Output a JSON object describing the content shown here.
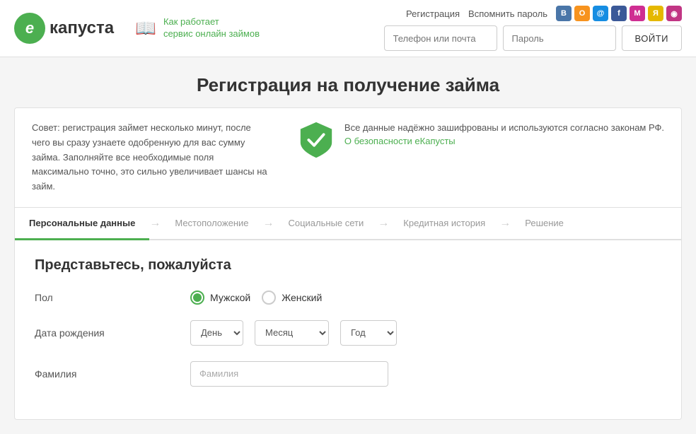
{
  "header": {
    "logo_letter": "е",
    "logo_name": "капуста",
    "how_it_works_line1": "Как работает",
    "how_it_works_line2": "сервис онлайн займов",
    "links": {
      "register": "Регистрация",
      "forgot": "Вспомнить пароль"
    },
    "social_icons": [
      {
        "name": "vk",
        "color": "#4a76a8",
        "label": "ВК"
      },
      {
        "name": "ok",
        "color": "#f7931e",
        "label": "ОК"
      },
      {
        "name": "mail",
        "color": "#168de2",
        "label": "@"
      },
      {
        "name": "fb",
        "color": "#3b5998",
        "label": "f"
      },
      {
        "name": "my",
        "color": "#cf2e92",
        "label": "М"
      },
      {
        "name": "ya",
        "color": "#ffcc00",
        "label": "Я"
      },
      {
        "name": "inst",
        "color": "#c13584",
        "label": "◉"
      }
    ],
    "phone_placeholder": "Телефон или почта",
    "password_placeholder": "Пароль",
    "login_button": "ВОЙТИ"
  },
  "page_title": "Регистрация на получение займа",
  "info_banner": {
    "tip_text": "Совет: регистрация займет несколько минут, после чего вы сразу узнаете одобренную для вас сумму займа. Заполняйте все необходимые поля максимально точно, это сильно увеличивает шансы на займ.",
    "security_text": "Все данные надёжно зашифрованы и используются согласно законам РФ.",
    "security_link": "О безопасности еКапусты"
  },
  "steps": [
    {
      "label": "Персональные данные",
      "active": true
    },
    {
      "label": "Местоположение",
      "active": false
    },
    {
      "label": "Социальные сети",
      "active": false
    },
    {
      "label": "Кредитная история",
      "active": false
    },
    {
      "label": "Решение",
      "active": false
    }
  ],
  "form": {
    "section_title": "Представьтесь, пожалуйста",
    "gender_label": "Пол",
    "gender_options": [
      {
        "value": "male",
        "label": "Мужской",
        "checked": true
      },
      {
        "value": "female",
        "label": "Женский",
        "checked": false
      }
    ],
    "dob_label": "Дата рождения",
    "dob_day_placeholder": "День",
    "dob_month_placeholder": "Месяц",
    "dob_year_placeholder": "Год",
    "last_name_label": "Фамилия",
    "last_name_placeholder": "Фамилия"
  },
  "colors": {
    "green": "#4caf50",
    "green_dark": "#388e3c"
  }
}
